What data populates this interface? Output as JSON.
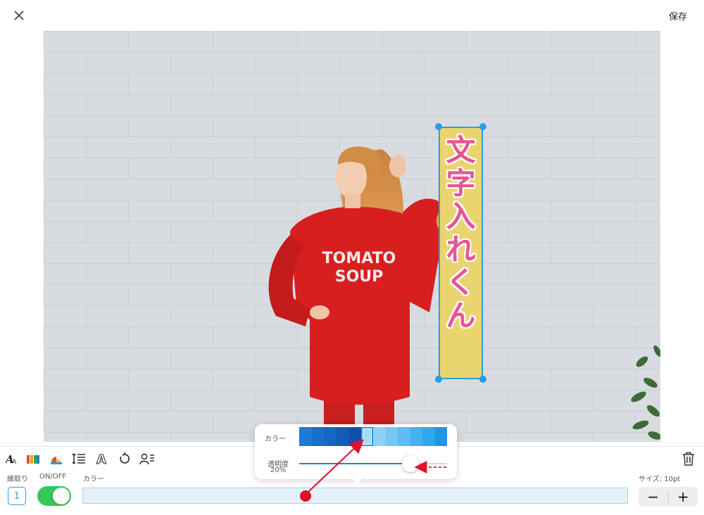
{
  "header": {
    "close_icon": "close-icon",
    "save_label": "保存"
  },
  "canvas": {
    "shirt_line1": "TOMATO",
    "shirt_line2": "SOUP",
    "text_box": {
      "characters": [
        "文",
        "字",
        "入",
        "れ",
        "く",
        "ん"
      ],
      "fill_color": "#ead46f",
      "text_color": "#e6558f"
    }
  },
  "toolbar": {
    "tools": [
      "font-icon",
      "color-palette-icon",
      "background-color-icon",
      "line-spacing-icon",
      "outline-text-icon",
      "rotate-icon",
      "vertical-text-icon"
    ],
    "trash_icon": "trash-icon"
  },
  "panel": {
    "stroke_label": "縁取り",
    "stroke_value": "1",
    "onoff_label": "ON/OFF",
    "toggle_on": true,
    "color_label": "カラー",
    "size_label": "サイズ: 10pt",
    "minus_label": "−",
    "plus_label": "+"
  },
  "popup": {
    "color_label": "カラー",
    "opacity_label": "透明度",
    "opacity_value": "20%",
    "opacity_level": 0.75,
    "swatches": [
      "#1e7ad6",
      "#1a6fcc",
      "#1865c2",
      "#155bb8",
      "#1250ad",
      "#a8dbf8",
      "#8fd0f6",
      "#77c6f4",
      "#5ebcf2",
      "#45b2f0",
      "#2ca8ee",
      "#1f97e2"
    ],
    "selected_swatch": 5
  },
  "colors": {
    "accent": "#2b9be6",
    "toggle": "#34c759",
    "annotation": "#e0102a"
  }
}
